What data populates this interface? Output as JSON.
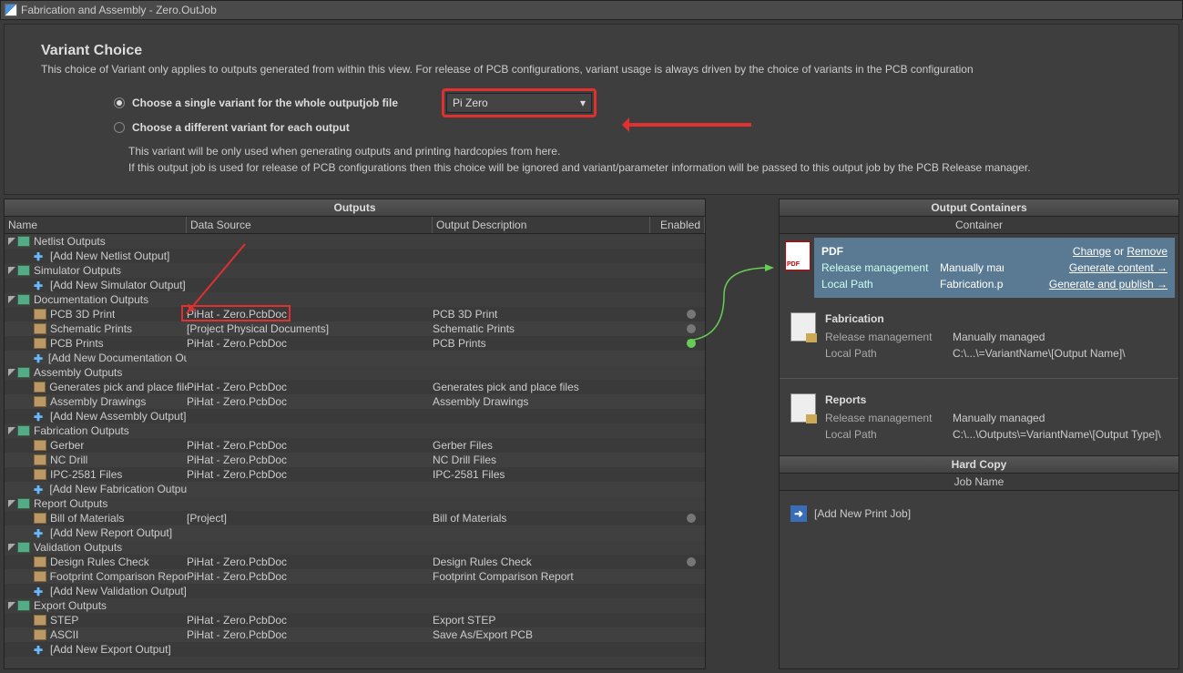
{
  "titlebar": {
    "title": "Fabrication and Assembly - Zero.OutJob"
  },
  "variant": {
    "heading": "Variant Choice",
    "desc": "This choice of Variant only applies to outputs generated from within this view. For release of PCB configurations, variant usage is always driven by the choice of variants in the PCB configuration",
    "radio1": "Choose a single variant for the whole outputjob file",
    "radio2": "Choose a different variant for each output",
    "combo": "Pi Zero",
    "note1": "This variant will be only used when generating outputs and printing hardcopies from here.",
    "note2": "If this output job is used for release of PCB configurations then this choice will be ignored and variant/parameter information will be passed to this output job by the PCB Release manager."
  },
  "outputs": {
    "title": "Outputs",
    "hdr_name": "Name",
    "hdr_ds": "Data Source",
    "hdr_desc": "Output Description",
    "hdr_en": "Enabled",
    "groups": {
      "netlist": "Netlist Outputs",
      "netlist_add": "[Add New Netlist Output]",
      "sim": "Simulator Outputs",
      "sim_add": "[Add New Simulator Output]",
      "doc": "Documentation Outputs",
      "doc_add": "[Add New Documentation Output]",
      "asm": "Assembly Outputs",
      "asm_add": "[Add New Assembly Output]",
      "fab": "Fabrication Outputs",
      "fab_add": "[Add New Fabrication Output]",
      "rep": "Report Outputs",
      "rep_add": "[Add New Report Output]",
      "val": "Validation Outputs",
      "val_add": "[Add New Validation Output]",
      "exp": "Export Outputs",
      "exp_add": "[Add New Export Output]"
    },
    "items": {
      "pcb3d": {
        "name": "PCB 3D Print",
        "ds": "PiHat - Zero.PcbDoc",
        "desc": "PCB 3D Print"
      },
      "schp": {
        "name": "Schematic Prints",
        "ds": "[Project Physical Documents]",
        "desc": "Schematic Prints"
      },
      "pcbp": {
        "name": "PCB Prints",
        "ds": "PiHat - Zero.PcbDoc",
        "desc": "PCB Prints"
      },
      "pnp": {
        "name": "Generates pick and place files",
        "ds": "PiHat - Zero.PcbDoc",
        "desc": "Generates pick and place files"
      },
      "asmd": {
        "name": "Assembly Drawings",
        "ds": "PiHat - Zero.PcbDoc",
        "desc": "Assembly Drawings"
      },
      "gerb": {
        "name": "Gerber",
        "ds": "PiHat - Zero.PcbDoc",
        "desc": "Gerber Files"
      },
      "ncd": {
        "name": "NC Drill",
        "ds": "PiHat - Zero.PcbDoc",
        "desc": "NC Drill Files"
      },
      "ipc": {
        "name": "IPC-2581 Files",
        "ds": "PiHat - Zero.PcbDoc",
        "desc": "IPC-2581 Files"
      },
      "bom": {
        "name": "Bill of Materials",
        "ds": "[Project]",
        "desc": "Bill of Materials"
      },
      "drc": {
        "name": "Design Rules Check",
        "ds": "PiHat - Zero.PcbDoc",
        "desc": "Design Rules Check"
      },
      "fcr": {
        "name": "Footprint Comparison Report",
        "ds": "PiHat - Zero.PcbDoc",
        "desc": "Footprint Comparison Report"
      },
      "step": {
        "name": "STEP",
        "ds": "PiHat - Zero.PcbDoc",
        "desc": "Export STEP"
      },
      "ascii": {
        "name": "ASCII",
        "ds": "PiHat - Zero.PcbDoc",
        "desc": "Save As/Export PCB"
      }
    }
  },
  "containers": {
    "title": "Output Containers",
    "sub": "Container",
    "pdf": {
      "title": "PDF",
      "rm_lbl": "Release management",
      "rm_val": "Manually managed",
      "lp_lbl": "Local Path",
      "lp_val": "Fabrication.pdf",
      "change": "Change",
      "or": "or",
      "remove": "Remove",
      "gen": "Generate content →",
      "pub": "Generate and publish →"
    },
    "fab": {
      "title": "Fabrication",
      "rm_lbl": "Release management",
      "rm_val": "Manually managed",
      "lp_lbl": "Local Path",
      "lp_val": "C:\\...\\=VariantName\\[Output Name]\\"
    },
    "rep": {
      "title": "Reports",
      "rm_lbl": "Release management",
      "rm_val": "Manually managed",
      "lp_lbl": "Local Path",
      "lp_val": "C:\\...\\Outputs\\=VariantName\\[Output Type]\\"
    },
    "hc_title": "Hard Copy",
    "hc_sub": "Job Name",
    "addjob": "[Add New Print Job]"
  }
}
